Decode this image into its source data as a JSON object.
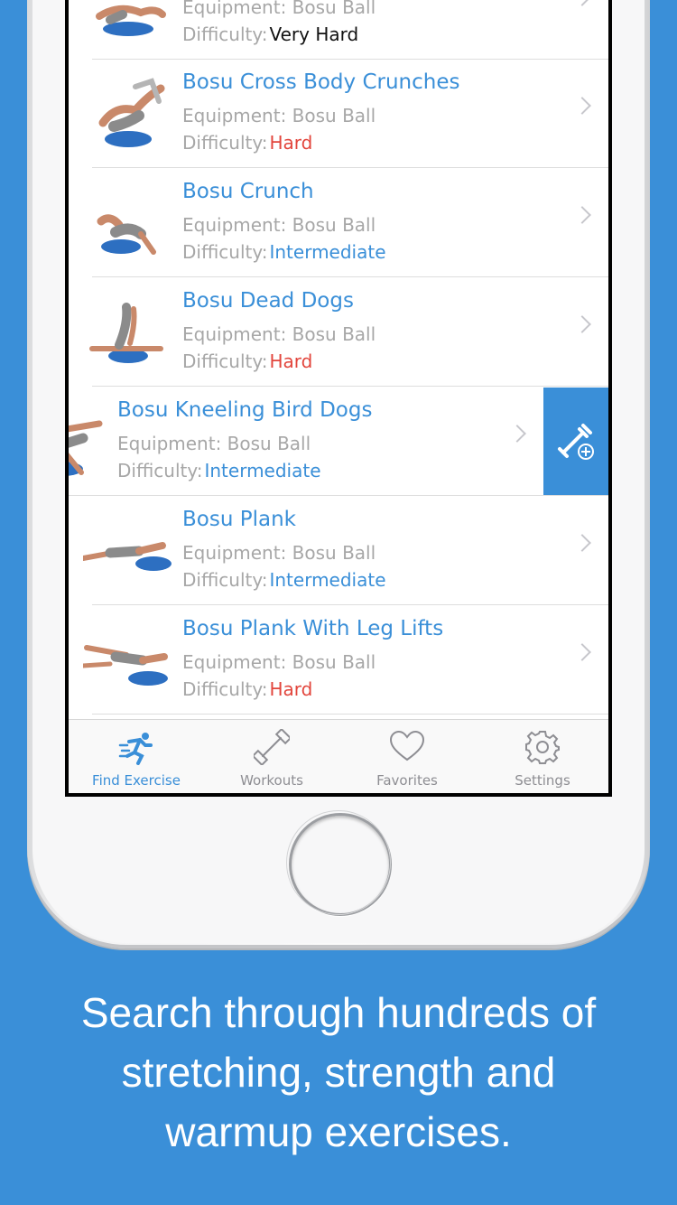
{
  "list": {
    "rows": [
      {
        "title": "",
        "equipment": "Equipment: Bosu Ball",
        "difficulty_label": "Difficulty:",
        "difficulty": "Very Hard",
        "level": "vhard"
      },
      {
        "title": "Bosu Cross Body Crunches",
        "equipment": "Equipment: Bosu Ball",
        "difficulty_label": "Difficulty:",
        "difficulty": "Hard",
        "level": "hard"
      },
      {
        "title": "Bosu Crunch",
        "equipment": "Equipment: Bosu Ball",
        "difficulty_label": "Difficulty:",
        "difficulty": "Intermediate",
        "level": "inter"
      },
      {
        "title": "Bosu Dead Dogs",
        "equipment": "Equipment: Bosu Ball",
        "difficulty_label": "Difficulty:",
        "difficulty": "Hard",
        "level": "hard"
      },
      {
        "title": "Bosu Kneeling Bird Dogs",
        "equipment": "Equipment: Bosu Ball",
        "difficulty_label": "Difficulty:",
        "difficulty": "Intermediate",
        "level": "inter"
      },
      {
        "title": "Bosu Plank",
        "equipment": "Equipment: Bosu Ball",
        "difficulty_label": "Difficulty:",
        "difficulty": "Intermediate",
        "level": "inter"
      },
      {
        "title": "Bosu Plank With Leg Lifts",
        "equipment": "Equipment: Bosu Ball",
        "difficulty_label": "Difficulty:",
        "difficulty": "Hard",
        "level": "hard"
      }
    ],
    "swipe_action_icon": "add-to-workout-icon"
  },
  "tabbar": {
    "tabs": [
      {
        "label": "Find Exercise",
        "icon": "running-person-icon",
        "active": true
      },
      {
        "label": "Workouts",
        "icon": "dumbbell-icon",
        "active": false
      },
      {
        "label": "Favorites",
        "icon": "heart-icon",
        "active": false
      },
      {
        "label": "Settings",
        "icon": "gear-icon",
        "active": false
      }
    ]
  },
  "caption": {
    "line1": "Search through hundreds of",
    "line2": "stretching, strength and",
    "line3": "warmup exercises."
  },
  "colors": {
    "background": "#3a8fd8",
    "accent": "#3a8fd8",
    "hard": "#e2453c",
    "secondary_text": "#a7a7a7"
  }
}
